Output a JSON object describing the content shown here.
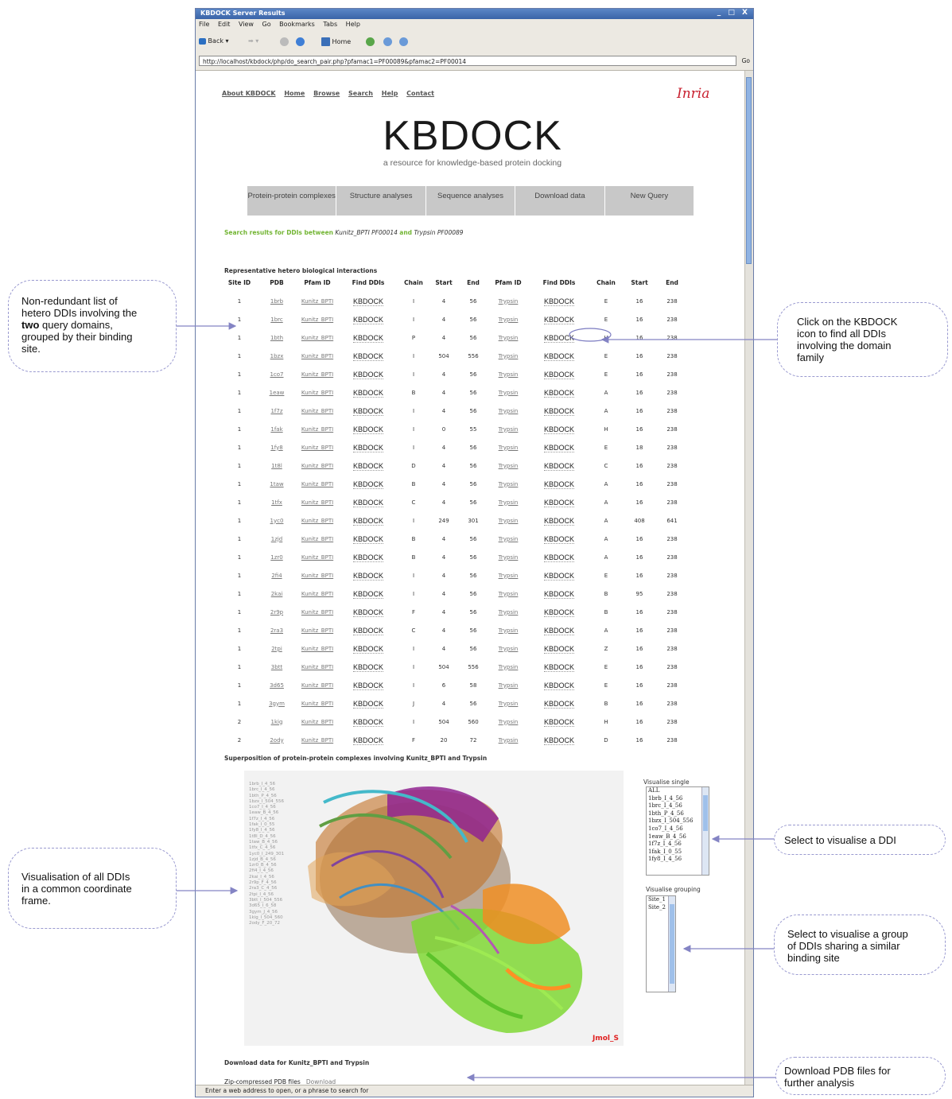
{
  "window": {
    "title": "KBDOCK Server Results",
    "controls": "_ □ X",
    "menu": [
      "File",
      "Edit",
      "View",
      "Go",
      "Bookmarks",
      "Tabs",
      "Help"
    ],
    "toolbar": {
      "back": "Back",
      "home": "Home"
    },
    "url": "http://localhost/kbdock/php/do_search_pair.php?pfamac1=PF00089&pfamac2=PF00014",
    "go": "Go",
    "status": "Enter a web address to open, or a phrase to search for"
  },
  "site": {
    "nav": [
      "About KBDOCK",
      "Home",
      "Browse",
      "Search",
      "Help",
      "Contact"
    ],
    "inria": "Inria",
    "logo": "KBDOCK",
    "tagline": "a resource for knowledge-based protein docking",
    "tabs": [
      "Protein-protein complexes",
      "Structure analyses",
      "Sequence analyses",
      "Download data",
      "New Query"
    ]
  },
  "search": {
    "prefix": "Search results for DDIs between",
    "domain1": "Kunitz_BPTI PF00014",
    "and": "and",
    "domain2": "Trypsin PF00089"
  },
  "table": {
    "title": "Representative hetero biological interactions",
    "headers": [
      "Site ID",
      "PDB",
      "Pfam ID",
      "Find DDIs",
      "Chain",
      "Start",
      "End",
      "Pfam ID",
      "Find DDIs",
      "Chain",
      "Start",
      "End"
    ],
    "rows": [
      [
        "1",
        "1brb",
        "Kunitz_BPTI",
        "KBDOCK",
        "I",
        "4",
        "56",
        "Trypsin",
        "KBDOCK",
        "E",
        "16",
        "238"
      ],
      [
        "1",
        "1brc",
        "Kunitz_BPTI",
        "KBDOCK",
        "I",
        "4",
        "56",
        "Trypsin",
        "KBDOCK",
        "E",
        "16",
        "238"
      ],
      [
        "1",
        "1bth",
        "Kunitz_BPTI",
        "KBDOCK",
        "P",
        "4",
        "56",
        "Trypsin",
        "KBDOCK",
        "H",
        "16",
        "238"
      ],
      [
        "1",
        "1bzx",
        "Kunitz_BPTI",
        "KBDOCK",
        "I",
        "504",
        "556",
        "Trypsin",
        "KBDOCK",
        "E",
        "16",
        "238"
      ],
      [
        "1",
        "1co7",
        "Kunitz_BPTI",
        "KBDOCK",
        "I",
        "4",
        "56",
        "Trypsin",
        "KBDOCK",
        "E",
        "16",
        "238"
      ],
      [
        "1",
        "1eaw",
        "Kunitz_BPTI",
        "KBDOCK",
        "B",
        "4",
        "56",
        "Trypsin",
        "KBDOCK",
        "A",
        "16",
        "238"
      ],
      [
        "1",
        "1f7z",
        "Kunitz_BPTI",
        "KBDOCK",
        "I",
        "4",
        "56",
        "Trypsin",
        "KBDOCK",
        "A",
        "16",
        "238"
      ],
      [
        "1",
        "1fak",
        "Kunitz_BPTI",
        "KBDOCK",
        "I",
        "0",
        "55",
        "Trypsin",
        "KBDOCK",
        "H",
        "16",
        "238"
      ],
      [
        "1",
        "1fy8",
        "Kunitz_BPTI",
        "KBDOCK",
        "I",
        "4",
        "56",
        "Trypsin",
        "KBDOCK",
        "E",
        "18",
        "238"
      ],
      [
        "1",
        "1t8l",
        "Kunitz_BPTI",
        "KBDOCK",
        "D",
        "4",
        "56",
        "Trypsin",
        "KBDOCK",
        "C",
        "16",
        "238"
      ],
      [
        "1",
        "1taw",
        "Kunitz_BPTI",
        "KBDOCK",
        "B",
        "4",
        "56",
        "Trypsin",
        "KBDOCK",
        "A",
        "16",
        "238"
      ],
      [
        "1",
        "1tfx",
        "Kunitz_BPTI",
        "KBDOCK",
        "C",
        "4",
        "56",
        "Trypsin",
        "KBDOCK",
        "A",
        "16",
        "238"
      ],
      [
        "1",
        "1yc0",
        "Kunitz_BPTI",
        "KBDOCK",
        "I",
        "249",
        "301",
        "Trypsin",
        "KBDOCK",
        "A",
        "408",
        "641"
      ],
      [
        "1",
        "1zjd",
        "Kunitz_BPTI",
        "KBDOCK",
        "B",
        "4",
        "56",
        "Trypsin",
        "KBDOCK",
        "A",
        "16",
        "238"
      ],
      [
        "1",
        "1zr0",
        "Kunitz_BPTI",
        "KBDOCK",
        "B",
        "4",
        "56",
        "Trypsin",
        "KBDOCK",
        "A",
        "16",
        "238"
      ],
      [
        "1",
        "2fi4",
        "Kunitz_BPTI",
        "KBDOCK",
        "I",
        "4",
        "56",
        "Trypsin",
        "KBDOCK",
        "E",
        "16",
        "238"
      ],
      [
        "1",
        "2kai",
        "Kunitz_BPTI",
        "KBDOCK",
        "I",
        "4",
        "56",
        "Trypsin",
        "KBDOCK",
        "B",
        "95",
        "238"
      ],
      [
        "1",
        "2r9p",
        "Kunitz_BPTI",
        "KBDOCK",
        "F",
        "4",
        "56",
        "Trypsin",
        "KBDOCK",
        "B",
        "16",
        "238"
      ],
      [
        "1",
        "2ra3",
        "Kunitz_BPTI",
        "KBDOCK",
        "C",
        "4",
        "56",
        "Trypsin",
        "KBDOCK",
        "A",
        "16",
        "238"
      ],
      [
        "1",
        "2tpi",
        "Kunitz_BPTI",
        "KBDOCK",
        "I",
        "4",
        "56",
        "Trypsin",
        "KBDOCK",
        "Z",
        "16",
        "238"
      ],
      [
        "1",
        "3btt",
        "Kunitz_BPTI",
        "KBDOCK",
        "I",
        "504",
        "556",
        "Trypsin",
        "KBDOCK",
        "E",
        "16",
        "238"
      ],
      [
        "1",
        "3d65",
        "Kunitz_BPTI",
        "KBDOCK",
        "I",
        "6",
        "58",
        "Trypsin",
        "KBDOCK",
        "E",
        "16",
        "238"
      ],
      [
        "1",
        "3gym",
        "Kunitz_BPTI",
        "KBDOCK",
        "J",
        "4",
        "56",
        "Trypsin",
        "KBDOCK",
        "B",
        "16",
        "238"
      ],
      [
        "2",
        "1kig",
        "Kunitz_BPTI",
        "KBDOCK",
        "I",
        "504",
        "560",
        "Trypsin",
        "KBDOCK",
        "H",
        "16",
        "238"
      ],
      [
        "2",
        "2ody",
        "Kunitz_BPTI",
        "KBDOCK",
        "F",
        "20",
        "72",
        "Trypsin",
        "KBDOCK",
        "D",
        "16",
        "238"
      ]
    ]
  },
  "superposition": {
    "title": "Superposition of protein-protein complexes involving Kunitz_BPTI and Trypsin",
    "labels": [
      "1brb_I_4_56",
      "1brc_I_4_56",
      "1bth_P_4_56",
      "1bzx_I_504_556",
      "1co7_I_4_56",
      "1eaw_B_4_56",
      "1f7z_I_4_56",
      "1fak_I_0_55",
      "1fy8_I_4_56",
      "1t8l_D_4_56",
      "1taw_B_4_56",
      "1tfx_C_4_56",
      "1yc0_I_249_301",
      "1zjd_B_4_56",
      "1zr0_B_4_56",
      "2fi4_I_4_56",
      "2kai_I_4_56",
      "2r9p_F_4_56",
      "2ra3_C_4_56",
      "2tpi_I_4_56",
      "3btt_I_504_556",
      "3d65_I_6_58",
      "3gym_J_4_56",
      "1kig_I_504_560",
      "2ody_F_20_72"
    ],
    "jmol": "Jmol_S",
    "visualise_single_label": "Visualise single",
    "single_options": [
      "ALL",
      "1brb_I_4_56",
      "1brc_I_4_56",
      "1bth_P_4_56",
      "1bzx_I_504_556",
      "1co7_I_4_56",
      "1eaw_B_4_56",
      "1f7z_I_4_56",
      "1fak_I_0_55",
      "1fy8_I_4_56"
    ],
    "visualise_grouping_label": "Visualise grouping",
    "group_options": [
      "Site_1",
      "Site_2"
    ]
  },
  "download": {
    "title": "Download data for Kunitz_BPTI and Trypsin",
    "label": "Zip-compressed PDB files",
    "link": "Download"
  },
  "annotations": {
    "list": [
      "Non-redundant list of",
      "hetero DDIs involving the",
      "query domains,",
      "grouped by their binding",
      "site."
    ],
    "list_bold": "two",
    "click": [
      "Click on the KBDOCK",
      "icon to find all DDIs",
      "involving the domain",
      "family"
    ],
    "visual": [
      "Visualisation of all DDIs",
      "in a common coordinate",
      "frame."
    ],
    "select": "Select to visualise a DDI",
    "group": [
      "Select to visualise a group",
      "of DDIs sharing a similar",
      "binding site"
    ],
    "download": [
      "Download PDB files for",
      "further analysis"
    ]
  },
  "colors": {
    "accent_green": "#73b534",
    "inria_red": "#c8202f",
    "callout_border": "#9a9ad0",
    "arrow": "#8484c4"
  }
}
